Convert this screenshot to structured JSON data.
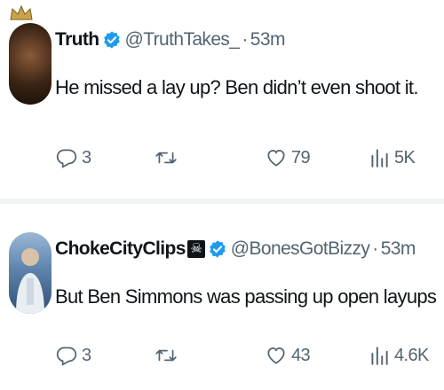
{
  "tweets": [
    {
      "name": "Truth",
      "handle": "@TruthTakes_",
      "separator": "·",
      "time": "53m",
      "text": "He missed a lay up? Ben didn’t even shoot it.",
      "replies": "3",
      "likes": "79",
      "views": "5K",
      "avatar_icon": "crowned-avatar"
    },
    {
      "name": "ChokeCityClips",
      "name_emoji": "☠",
      "handle": "@BonesGotBizzy",
      "separator": "·",
      "time": "53m",
      "text": "But Ben Simmons was passing up open layups",
      "replies": "3",
      "likes": "43",
      "views": "4.6K",
      "avatar_icon": "person-avatar"
    }
  ],
  "colors": {
    "verified": "#1d9bf0",
    "secondary_text": "#536471",
    "primary_text": "#0f1419"
  }
}
